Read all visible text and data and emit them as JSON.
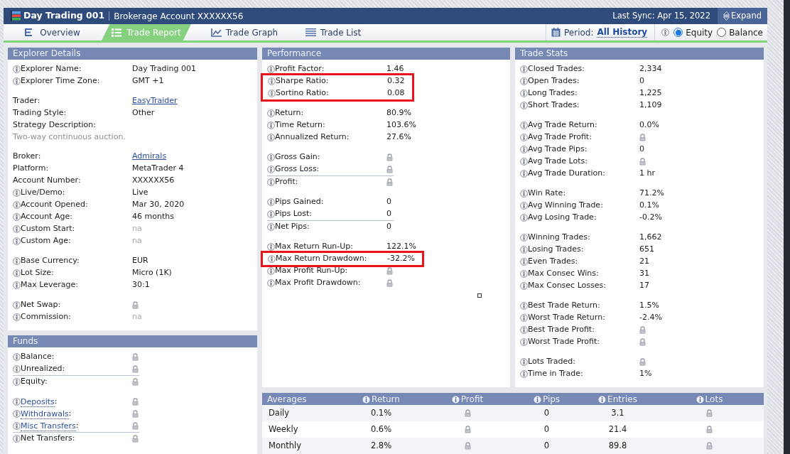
{
  "header": {
    "title": "Day Trading 001",
    "subtitle": "Brokerage Account XXXXXX56",
    "last_sync": "Last Sync: Apr 15, 2022",
    "expand_button": "Expand"
  },
  "tabs": [
    {
      "label": "Overview",
      "kind": "overview",
      "selected": false
    },
    {
      "label": "Trade Report",
      "kind": "report",
      "selected": true
    },
    {
      "label": "Trade Graph",
      "kind": "graph",
      "selected": false
    },
    {
      "label": "Trade List",
      "kind": "list",
      "selected": false
    }
  ],
  "period": {
    "label": "Period:",
    "value": "All History"
  },
  "basis": [
    {
      "label": "Equity",
      "selected": true
    },
    {
      "label": "Balance",
      "selected": false
    }
  ],
  "left_panels": [
    {
      "title": "Explorer Details",
      "groups": [
        [
          {
            "label": "Explorer Name:",
            "info": true,
            "value": "Day Trading 001"
          },
          {
            "label": "Explorer Time Zone:",
            "info": true,
            "value": "GMT +1"
          }
        ],
        [
          {
            "label": "Trader:",
            "info": false,
            "value": "EasyTraider",
            "value_link": true
          },
          {
            "label": "Trading Style:",
            "info": false,
            "value": "Other"
          },
          {
            "label": "Strategy Description:",
            "info": false
          },
          {
            "kind": "note",
            "text": "Two-way continuous auction."
          }
        ],
        [
          {
            "label": "Broker:",
            "info": false,
            "value": "Admirals",
            "value_link": true
          },
          {
            "label": "Platform:",
            "info": false,
            "value": "MetaTrader 4"
          },
          {
            "label": "Account Number:",
            "info": false,
            "value": "XXXXXX56"
          },
          {
            "label": "Live/Demo:",
            "info": true,
            "value": "Live"
          },
          {
            "label": "Account Opened:",
            "info": true,
            "value": "Mar 30, 2020"
          },
          {
            "label": "Account Age:",
            "info": true,
            "value": "46 months"
          },
          {
            "label": "Custom Start:",
            "info": true,
            "value": "na",
            "muted": true
          },
          {
            "label": "Custom Age:",
            "info": true,
            "value": "na",
            "muted": true
          }
        ],
        [
          {
            "label": "Base Currency:",
            "info": true,
            "value": "EUR"
          },
          {
            "label": "Lot Size:",
            "info": true,
            "value": "Micro (1K)"
          },
          {
            "label": "Max Leverage:",
            "info": true,
            "value": "30:1"
          }
        ],
        [
          {
            "label": "Net Swap:",
            "info": true,
            "locked": true
          },
          {
            "label": "Commission:",
            "info": true,
            "value": "na",
            "muted": true
          }
        ]
      ]
    },
    {
      "title": "Funds",
      "groups": [
        [
          {
            "label": "Balance:",
            "info": true,
            "locked": true
          },
          {
            "label": "Unrealized:",
            "info": true,
            "locked": true
          },
          {
            "label": "Equity:",
            "info": true,
            "locked": true,
            "rule_above": true
          }
        ],
        [
          {
            "label": "Deposits",
            "label_suffix": ":",
            "info": true,
            "locked": true,
            "label_link": true
          },
          {
            "label": "Withdrawals",
            "label_suffix": ":",
            "info": true,
            "locked": true,
            "label_link": true
          },
          {
            "label": "Misc Transfers",
            "label_suffix": ":",
            "info": true,
            "locked": true,
            "label_link": true
          },
          {
            "label": "Net Transfers:",
            "info": true,
            "locked": true,
            "rule_above": true
          }
        ]
      ]
    }
  ],
  "performance": {
    "title": "Performance",
    "groups": [
      [
        {
          "label": "Profit Factor:",
          "info": true,
          "value": "1.46",
          "highlighted": false
        },
        {
          "label": "Sharpe Ratio:",
          "info": true,
          "value": "0.32",
          "highlighted": true
        },
        {
          "label": "Sortino Ratio:",
          "info": true,
          "value": "0.08",
          "highlighted": true
        }
      ],
      [
        {
          "label": "Return:",
          "info": true,
          "value": "80.9%",
          "highlighted": false
        },
        {
          "label": "Time Return:",
          "info": true,
          "value": "103.6%",
          "highlighted": false
        },
        {
          "label": "Annualized Return:",
          "info": true,
          "value": "27.6%",
          "highlighted": false
        }
      ],
      [
        {
          "label": "Gross Gain:",
          "info": true,
          "locked": true,
          "highlighted": false
        },
        {
          "label": "Gross Loss:",
          "info": true,
          "locked": true,
          "highlighted": false
        },
        {
          "label": "Profit:",
          "info": true,
          "locked": true,
          "rule_above": true,
          "highlighted": false
        }
      ],
      [
        {
          "label": "Pips Gained:",
          "info": true,
          "value": "0",
          "highlighted": false
        },
        {
          "label": "Pips Lost:",
          "info": true,
          "value": "0",
          "highlighted": false
        },
        {
          "label": "Net Pips:",
          "info": true,
          "value": "0",
          "rule_above": true,
          "highlighted": false
        }
      ],
      [
        {
          "label": "Max Return Run-Up:",
          "info": true,
          "value": "122.1%",
          "highlighted": false
        },
        {
          "label": "Max Return Drawdown:",
          "info": true,
          "value": "-32.2%",
          "highlighted": true
        },
        {
          "label": "Max Profit Run-Up:",
          "info": true,
          "locked": true,
          "highlighted": false
        },
        {
          "label": "Max Profit Drawdown:",
          "info": true,
          "locked": true,
          "highlighted": false
        }
      ]
    ]
  },
  "trade_stats": {
    "title": "Trade Stats",
    "groups": [
      [
        {
          "label": "Closed Trades:",
          "info": true,
          "value": "2,334"
        },
        {
          "label": "Open Trades:",
          "info": true,
          "value": "0"
        },
        {
          "label": "Long Trades:",
          "info": true,
          "value": "1,225"
        },
        {
          "label": "Short Trades:",
          "info": true,
          "value": "1,109"
        }
      ],
      [
        {
          "label": "Avg Trade Return:",
          "info": true,
          "value": "0.0%"
        },
        {
          "label": "Avg Trade Profit:",
          "info": true,
          "locked": true
        },
        {
          "label": "Avg Trade Pips:",
          "info": true,
          "value": "0"
        },
        {
          "label": "Avg Trade Lots:",
          "info": true,
          "locked": true
        },
        {
          "label": "Avg Trade Duration:",
          "info": true,
          "value": "1 hr"
        }
      ],
      [
        {
          "label": "Win Rate:",
          "info": true,
          "value": "71.2%"
        },
        {
          "label": "Avg Winning Trade:",
          "info": true,
          "value": "0.1%"
        },
        {
          "label": "Avg Losing Trade:",
          "info": true,
          "value": "-0.2%"
        }
      ],
      [
        {
          "label": "Winning Trades:",
          "info": true,
          "value": "1,662"
        },
        {
          "label": "Losing Trades:",
          "info": true,
          "value": "651"
        },
        {
          "label": "Even Trades:",
          "info": true,
          "value": "21"
        },
        {
          "label": "Max Consec Wins:",
          "info": true,
          "value": "31"
        },
        {
          "label": "Max Consec Losses:",
          "info": true,
          "value": "17"
        }
      ],
      [
        {
          "label": "Best Trade Return:",
          "info": true,
          "value": "1.5%"
        },
        {
          "label": "Worst Trade Return:",
          "info": true,
          "value": "-2.4%"
        },
        {
          "label": "Best Trade Profit:",
          "info": true,
          "locked": true
        },
        {
          "label": "Worst Trade Profit:",
          "info": true,
          "locked": true
        }
      ],
      [
        {
          "label": "Lots Traded:",
          "info": true,
          "locked": true
        },
        {
          "label": "Time in Trade:",
          "info": true,
          "value": "1%"
        }
      ]
    ]
  },
  "averages": {
    "columns": [
      {
        "label": "Averages",
        "info": false
      },
      {
        "label": "Return",
        "info": true
      },
      {
        "label": "Profit",
        "info": true
      },
      {
        "label": "Pips",
        "info": true
      },
      {
        "label": "Entries",
        "info": true
      },
      {
        "label": "Lots",
        "info": true
      }
    ],
    "rows": [
      {
        "cells": [
          {
            "value": "Daily"
          },
          {
            "value": "0.1%"
          },
          {
            "locked": true
          },
          {
            "value": "0"
          },
          {
            "value": "3.1"
          },
          {
            "locked": true
          }
        ]
      },
      {
        "cells": [
          {
            "value": "Weekly"
          },
          {
            "value": "0.6%"
          },
          {
            "locked": true
          },
          {
            "value": "0"
          },
          {
            "value": "21.4"
          },
          {
            "locked": true
          }
        ]
      },
      {
        "cells": [
          {
            "value": "Monthly"
          },
          {
            "value": "2.8%"
          },
          {
            "locked": true
          },
          {
            "value": "0"
          },
          {
            "value": "89.8"
          },
          {
            "locked": true
          }
        ]
      }
    ]
  }
}
